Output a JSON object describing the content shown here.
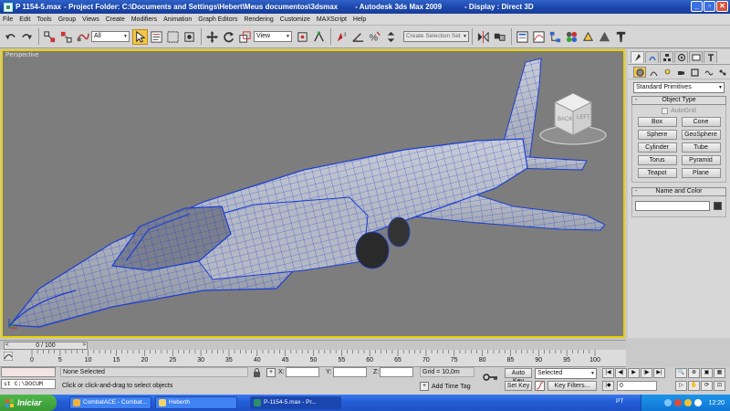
{
  "window": {
    "title_file": "P 1154-5.max",
    "title_folder": "- Project Folder: C:\\Documents and Settings\\Hebert\\Meus documentos\\3dsmax",
    "title_app": "- Autodesk 3ds Max  2009",
    "title_display": "- Display : Direct 3D"
  },
  "menu": [
    "File",
    "Edit",
    "Tools",
    "Group",
    "Views",
    "Create",
    "Modifiers",
    "Animation",
    "Graph Editors",
    "Rendering",
    "Customize",
    "MAXScript",
    "Help"
  ],
  "toolbar": {
    "selection_filter": "All",
    "coord_system": "View",
    "named_selection_placeholder": "Create Selection Set",
    "icons": [
      "undo-icon",
      "redo-icon",
      "select-link-icon",
      "unlink-icon",
      "bind-space-warp-icon",
      "select-object-icon",
      "select-by-name-icon",
      "region-select-icon",
      "window-crossing-icon",
      "move-icon",
      "rotate-icon",
      "scale-icon",
      "pivot-icon",
      "select-manipulate-icon",
      "snaps-3d-icon",
      "angle-snap-icon",
      "percent-snap-icon",
      "spinner-snap-icon",
      "mirror-icon",
      "align-icon",
      "layer-manager-icon",
      "curve-editor-icon",
      "schematic-view-icon",
      "material-editor-icon",
      "render-setup-icon",
      "rendered-frame-icon",
      "quick-render-icon"
    ]
  },
  "viewport": {
    "label": "Perspective",
    "viewcube_left": "LEFT",
    "viewcube_back": "BACK"
  },
  "command_panel": {
    "category": "Standard Primitives",
    "object_type_title": "Object Type",
    "autogrid": "AutoGrid",
    "objects": [
      "Box",
      "Cone",
      "Sphere",
      "GeoSphere",
      "Cylinder",
      "Tube",
      "Torus",
      "Pyramid",
      "Teapot",
      "Plane"
    ],
    "name_color_title": "Name and Color",
    "rollout_toggle": "-"
  },
  "timeline": {
    "slider_text": "0 / 100",
    "tick_labels": [
      "0",
      "5",
      "10",
      "15",
      "20",
      "25",
      "30",
      "35",
      "40",
      "45",
      "50",
      "55",
      "60",
      "65",
      "70",
      "75",
      "80",
      "85",
      "90",
      "95",
      "100"
    ]
  },
  "status": {
    "maxscript_listener": "st C:\\DOCUM",
    "selection_info": "None Selected",
    "prompt": "Click or click-and-drag to select objects",
    "x_label": "X:",
    "y_label": "Y:",
    "z_label": "Z:",
    "grid": "Grid = 10,0m",
    "add_time_tag": "Add Time Tag",
    "auto_key": "Auto Key",
    "set_key": "Set Key",
    "key_mode_select": "Selected",
    "key_filters": "Key Filters...",
    "current_frame": "0"
  },
  "taskbar": {
    "start": "Iniciar",
    "tasks": [
      "CombatACE - Combat...",
      "Heberth",
      "P-1154-5.max     - Pr..."
    ],
    "language": "PT",
    "clock": "12:20"
  },
  "colors": {
    "viewport_bg": "#7d7d7d",
    "active_viewport_border": "#e8d100",
    "wireframe": "#1c3fd0",
    "title_bar": "#1f4cb2",
    "taskbar": "#245fd8",
    "start_button": "#3fa63a"
  }
}
